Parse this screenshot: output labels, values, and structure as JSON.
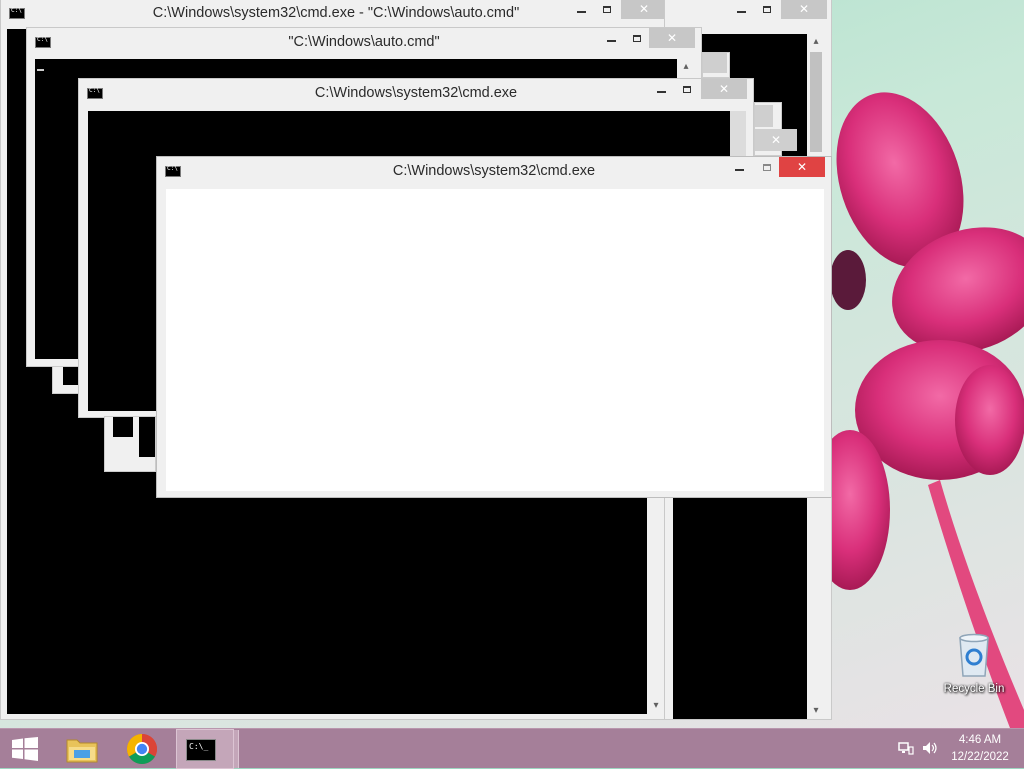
{
  "windows": [
    {
      "id": "w1",
      "title": "C:\\Windows\\system32\\cmd.exe - \"C:\\Windows\\auto.cmd\""
    },
    {
      "id": "w1b",
      "title": ""
    },
    {
      "id": "w2",
      "title": "\"C:\\Windows\\auto.cmd\""
    },
    {
      "id": "w3",
      "title": "C:\\Windows\\system32\\cmd.exe"
    },
    {
      "id": "w4",
      "title": "C:\\Windows\\system32\\cmd.exe"
    }
  ],
  "desktop": {
    "recycle_bin_label": "Recycle Bin"
  },
  "taskbar": {
    "items": [
      {
        "name": "start",
        "icon": "windows-logo-icon"
      },
      {
        "name": "file-explorer",
        "icon": "folder-icon"
      },
      {
        "name": "chrome",
        "icon": "chrome-icon"
      },
      {
        "name": "command-prompt",
        "icon": "cmd-icon",
        "active": true
      }
    ],
    "clock_time": "4:46 AM",
    "clock_date": "12/22/2022"
  },
  "colors": {
    "taskbar": "#a57f99",
    "close_active": "#e04343",
    "console_bg": "#000000",
    "flower": "#e0307a"
  }
}
